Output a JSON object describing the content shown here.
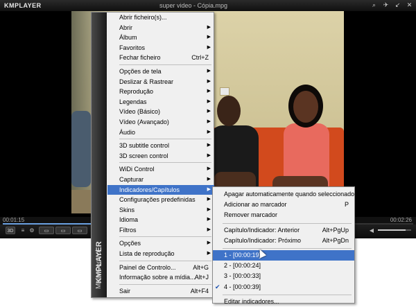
{
  "window": {
    "logo": "KMPLAYER",
    "title": "super video - Cópia.mpg",
    "buttons": [
      "⌕",
      "✈",
      "↙",
      "✕"
    ]
  },
  "player": {
    "time_current": "00:01:15",
    "time_total": "00:02:26",
    "progress": 0.51,
    "volume": 0.83,
    "controls": {
      "btn_3d": "3D",
      "btn_a": "≡",
      "btn_b": "⚙",
      "btn_c": "▭",
      "btn_d": "▭",
      "btn_e": "▭"
    }
  },
  "main_menu": {
    "sidebar_brand": "KMPLAYER",
    "sidebar_sub": "Main Control",
    "items": [
      {
        "label": "Abrir ficheiro(s)...",
        "shortcut": "",
        "arrow": false
      },
      {
        "label": "Abrir",
        "shortcut": "",
        "arrow": true
      },
      {
        "label": "Álbum",
        "shortcut": "",
        "arrow": true
      },
      {
        "label": "Favoritos",
        "shortcut": "",
        "arrow": true
      },
      {
        "label": "Fechar ficheiro",
        "shortcut": "Ctrl+Z",
        "arrow": false
      },
      {
        "label": "Opções de tela",
        "shortcut": "",
        "arrow": true
      },
      {
        "label": "Deslizar & Rastrear",
        "shortcut": "",
        "arrow": true
      },
      {
        "label": "Reprodução",
        "shortcut": "",
        "arrow": true
      },
      {
        "label": "Legendas",
        "shortcut": "",
        "arrow": true
      },
      {
        "label": "Vídeo (Básico)",
        "shortcut": "",
        "arrow": true
      },
      {
        "label": "Vídeo (Avançado)",
        "shortcut": "",
        "arrow": true
      },
      {
        "label": "Áudio",
        "shortcut": "",
        "arrow": true
      },
      {
        "label": "3D subtitle control",
        "shortcut": "",
        "arrow": true
      },
      {
        "label": "3D screen control",
        "shortcut": "",
        "arrow": true
      },
      {
        "label": "WiDi Control",
        "shortcut": "",
        "arrow": true
      },
      {
        "label": "Capturar",
        "shortcut": "",
        "arrow": true
      },
      {
        "label": "Indicadores/Capítulos",
        "shortcut": "",
        "arrow": true
      },
      {
        "label": "Configurações predefinidas",
        "shortcut": "",
        "arrow": true
      },
      {
        "label": "Skins",
        "shortcut": "",
        "arrow": true
      },
      {
        "label": "Idioma",
        "shortcut": "",
        "arrow": true
      },
      {
        "label": "Filtros",
        "shortcut": "",
        "arrow": true
      },
      {
        "label": "Opções",
        "shortcut": "",
        "arrow": true
      },
      {
        "label": "Lista de reprodução",
        "shortcut": "",
        "arrow": true
      },
      {
        "label": "Painel de Controlo...",
        "shortcut": "Alt+G",
        "arrow": false
      },
      {
        "label": "Informação sobre a mídia...",
        "shortcut": "Alt+J",
        "arrow": false
      },
      {
        "label": "Sair",
        "shortcut": "Alt+F4",
        "arrow": false
      }
    ]
  },
  "sub_menu": {
    "items": [
      {
        "label": "Apagar automaticamente quando seleccionado",
        "shortcut": ""
      },
      {
        "label": "Adicionar ao marcador",
        "shortcut": "P"
      },
      {
        "label": "Remover marcador",
        "shortcut": ""
      },
      {
        "label": "Capítulo/Indicador: Anterior",
        "shortcut": "Alt+PgUp"
      },
      {
        "label": "Capítulo/Indicador: Próximo",
        "shortcut": "Alt+PgDn"
      },
      {
        "label": "1 - [00:00:19]",
        "shortcut": ""
      },
      {
        "label": "2 - [00:00:24]",
        "shortcut": ""
      },
      {
        "label": "3 - [00:00:33]",
        "shortcut": ""
      },
      {
        "label": "4 - [00:00:39]",
        "shortcut": ""
      },
      {
        "label": "Editar indicadores...",
        "shortcut": ""
      }
    ]
  }
}
